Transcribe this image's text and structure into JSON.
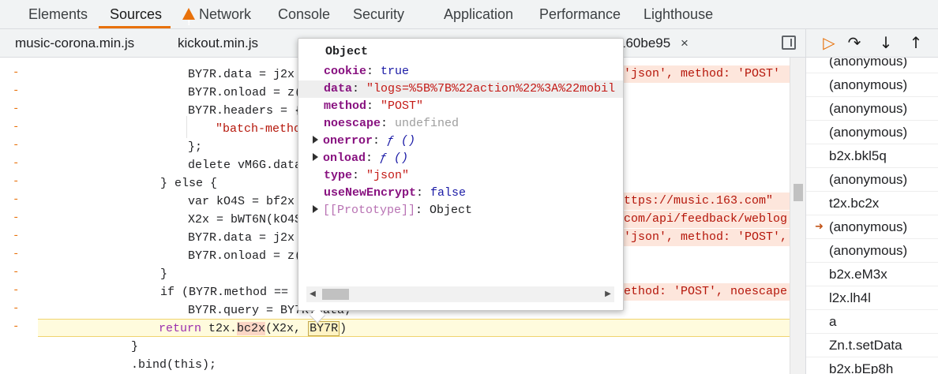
{
  "panel_tabs": [
    {
      "label": "Elements"
    },
    {
      "label": "Sources"
    },
    {
      "label": "Network"
    },
    {
      "label": "Console"
    },
    {
      "label": "Security"
    },
    {
      "label": "Application"
    },
    {
      "label": "Performance"
    },
    {
      "label": "Lighthouse"
    }
  ],
  "file_tabs": [
    {
      "label": "music-corona.min.js"
    },
    {
      "label": "kickout.min.js"
    },
    {
      "label": "160be95"
    }
  ],
  "file_close": "×",
  "code": {
    "gutter_mark": "-",
    "lines": [
      {
        "text": "BY7R.data = j2x"
      },
      {
        "text": "BY7R.onload = z("
      },
      {
        "text": "BY7R.headers = {"
      },
      {
        "text": "\"batch-metho"
      },
      {
        "text": "};"
      },
      {
        "text": "delete vM6G.data"
      },
      {
        "text": "} else {"
      },
      {
        "text": "var kO4S = bf2x"
      },
      {
        "text": "X2x = bWT6N(kO4S"
      },
      {
        "text": "BY7R.data = j2x"
      },
      {
        "text": "BY7R.onload = z("
      },
      {
        "text": "}"
      },
      {
        "text": "if (BY7R.method == '"
      },
      {
        "text": "BY7R.query = BY7R.data;"
      },
      {
        "text": "return t2x.bc2x(X2x, BY7R)"
      },
      {
        "text": "}"
      },
      {
        "text": ".bind(this);"
      }
    ],
    "right_fragments": [
      "'json', method: 'POST'",
      "ttps://music.163.com\"",
      "com/api/feedback/weblog",
      "'json', method: 'POST',",
      "ethod: 'POST', noescape:"
    ],
    "current_return": {
      "prefix": "return ",
      "obj": "t2x.",
      "fn": "bc2x",
      "args_a": "(X2x, ",
      "arg_b": "BY7R",
      "suffix": ")"
    }
  },
  "popover": {
    "title": "Object",
    "props": [
      {
        "key": "cookie",
        "sep": ": ",
        "value": "true",
        "kind": "bool"
      },
      {
        "key": "data",
        "sep": ": ",
        "value": "\"logs=%5B%7B%22action%22%3A%22mobil",
        "kind": "str"
      },
      {
        "key": "method",
        "sep": ": ",
        "value": "\"POST\"",
        "kind": "str"
      },
      {
        "key": "noescape",
        "sep": ": ",
        "value": "undefined",
        "kind": "undef"
      },
      {
        "key": "onerror",
        "sep": ": ",
        "value": "ƒ ()",
        "kind": "fn"
      },
      {
        "key": "onload",
        "sep": ": ",
        "value": "ƒ ()",
        "kind": "fn"
      },
      {
        "key": "type",
        "sep": ": ",
        "value": "\"json\"",
        "kind": "str"
      },
      {
        "key": "useNewEncrypt",
        "sep": ": ",
        "value": "false",
        "kind": "bool"
      },
      {
        "key": "[[Prototype]]",
        "sep": ": ",
        "value": "Object",
        "kind": "plain"
      }
    ]
  },
  "call_stack": [
    {
      "name": "(anonymous)"
    },
    {
      "name": "(anonymous)"
    },
    {
      "name": "(anonymous)"
    },
    {
      "name": "(anonymous)"
    },
    {
      "name": "b2x.bkl5q"
    },
    {
      "name": "(anonymous)"
    },
    {
      "name": "t2x.bc2x"
    },
    {
      "name": "(anonymous)"
    },
    {
      "name": "(anonymous)"
    },
    {
      "name": "b2x.eM3x"
    },
    {
      "name": "l2x.lh4l"
    },
    {
      "name": "a"
    },
    {
      "name": "Zn.t.setData"
    },
    {
      "name": "b2x.bEp8h"
    }
  ],
  "icons": {
    "network_warning": "warning-icon",
    "resume": "resume-icon",
    "step_over": "step-over-icon",
    "step_into": "step-into-icon",
    "step_out": "step-out-icon",
    "current_frame": "current-frame-arrow-icon"
  },
  "colors": {
    "accent": "#e8710a",
    "current_line_bg": "#fffbdd",
    "string": "#c41a16",
    "keyword": "#9b2fae"
  }
}
